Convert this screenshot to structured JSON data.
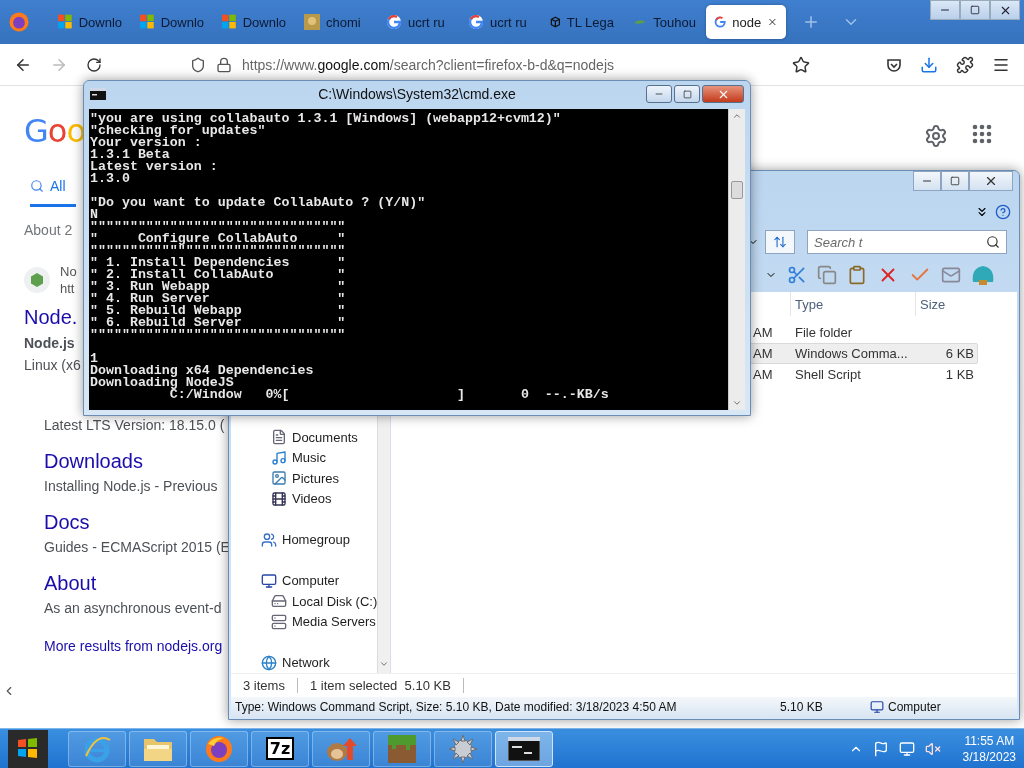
{
  "browser": {
    "tabs": [
      {
        "kind": "windows",
        "label": "Downlo",
        "selected": false
      },
      {
        "kind": "windows",
        "label": "Downlo",
        "selected": false
      },
      {
        "kind": "windows",
        "label": "Downlo",
        "selected": false
      },
      {
        "kind": "image",
        "label": "chomi",
        "selected": false
      },
      {
        "kind": "google",
        "label": "ucrt ru",
        "selected": false
      },
      {
        "kind": "google",
        "label": "ucrt ru",
        "selected": false
      },
      {
        "kind": "cube",
        "label": "TL Lega",
        "selected": false
      },
      {
        "kind": "leaf",
        "label": "Touhou",
        "selected": false
      },
      {
        "kind": "google",
        "label": "node",
        "selected": true
      }
    ],
    "forward": {
      "disabled": true
    },
    "url": {
      "scheme": "https://www.",
      "domain": "google.com",
      "path": "/search?client=firefox-b-d&q=nodejs"
    }
  },
  "google": {
    "logo": "Goo",
    "tabs": [
      {
        "label": "All",
        "selected": true
      }
    ],
    "result_count": "About 2",
    "site": {
      "name": "No",
      "url": "htt"
    },
    "result": {
      "title": "Node.",
      "snippet_title": "Node.js",
      "snippet": "Linux (x6"
    },
    "sitelinks": [
      {
        "snippet": "Latest LTS Version: 18.15.0 ("
      },
      {
        "title": "Downloads",
        "snippet": "Installing Node.js - Previous"
      },
      {
        "title": "Docs",
        "snippet": "Guides - ECMAScript 2015 (E"
      },
      {
        "title": "About",
        "snippet": "As an asynchronous event-d"
      }
    ],
    "more": "More results from nodejs.org"
  },
  "explorer": {
    "search": {
      "placeholder": "Search t"
    },
    "columns": [
      "Type",
      "Size"
    ],
    "rows": [
      {
        "date": "AM",
        "type": "File folder",
        "selected": false
      },
      {
        "date": "AM",
        "type": "Windows Comma...",
        "size": "6 KB",
        "selected": true
      },
      {
        "date": "AM",
        "type": "Shell Script",
        "size": "1 KB",
        "selected": false
      }
    ],
    "nav": [
      {
        "children": [
          {
            "kind": "documents",
            "label": "Documents"
          },
          {
            "kind": "music",
            "label": "Music"
          },
          {
            "kind": "pictures",
            "label": "Pictures"
          },
          {
            "kind": "videos",
            "label": "Videos"
          }
        ]
      },
      {
        "kind": "homegroup",
        "label": "Homegroup"
      },
      {
        "kind": "computer",
        "label": "Computer",
        "children": [
          {
            "kind": "disk",
            "label": "Local Disk (C:)"
          },
          {
            "kind": "server",
            "label": "Media Servers"
          }
        ]
      },
      {
        "kind": "network",
        "label": "Network"
      }
    ],
    "item_count": "3 items",
    "selection": "1 item selected  5.10 KB",
    "details": "Type: Windows Command Script, Size: 5.10 KB, Date modified: 3/18/2023 4:50 AM",
    "details_size": "5.10 KB",
    "location": "Computer"
  },
  "cmd": {
    "title": "C:\\Windows\\System32\\cmd.exe",
    "blocks": [
      [
        "\"you are using collabauto 1.3.1 [Windows] (webapp12+cvm12)\"",
        "\"checking for updates\"",
        "Your version :",
        "1.3.1 Beta",
        "Latest version :",
        "1.3.0"
      ],
      [
        "\"Do you want to update CollabAuto ? (Y/N)\"",
        "N",
        "\"\"\"\"\"\"\"\"\"\"\"\"\"\"\"\"\"\"\"\"\"\"\"\"\"\"\"\"\"\"\"\"",
        "\"     Configure CollabAuto     \"",
        "\"\"\"\"\"\"\"\"\"\"\"\"\"\"\"\"\"\"\"\"\"\"\"\"\"\"\"\"\"\"\"\"",
        "\" 1. Install Dependencies      \"",
        "\" 2. Install CollabAuto        \"",
        "\" 3. Run Webapp                \"",
        "\" 4. Run Server                \"",
        "\" 5. Rebuild Webapp            \"",
        "\" 6. Rebuild Server            \"",
        "\"\"\"\"\"\"\"\"\"\"\"\"\"\"\"\"\"\"\"\"\"\"\"\"\"\"\"\"\"\"\"\""
      ],
      [
        "1",
        "Downloading x64 Dependencies",
        "Downloading NodeJS",
        "          C:/Window   0%[                     ]       0  --.-KB/s"
      ]
    ]
  },
  "taskbar": {
    "apps": [
      {
        "kind": "ie",
        "selected": false
      },
      {
        "kind": "folder",
        "selected": false
      },
      {
        "kind": "firefox",
        "selected": false
      },
      {
        "kind": "sevenzip",
        "label": "7z",
        "selected": false
      },
      {
        "kind": "mascot",
        "selected": false
      },
      {
        "kind": "block",
        "selected": false
      },
      {
        "kind": "gear",
        "selected": false
      },
      {
        "kind": "console",
        "selected": true
      }
    ],
    "time": "11:55 AM",
    "date": "3/18/2023"
  }
}
